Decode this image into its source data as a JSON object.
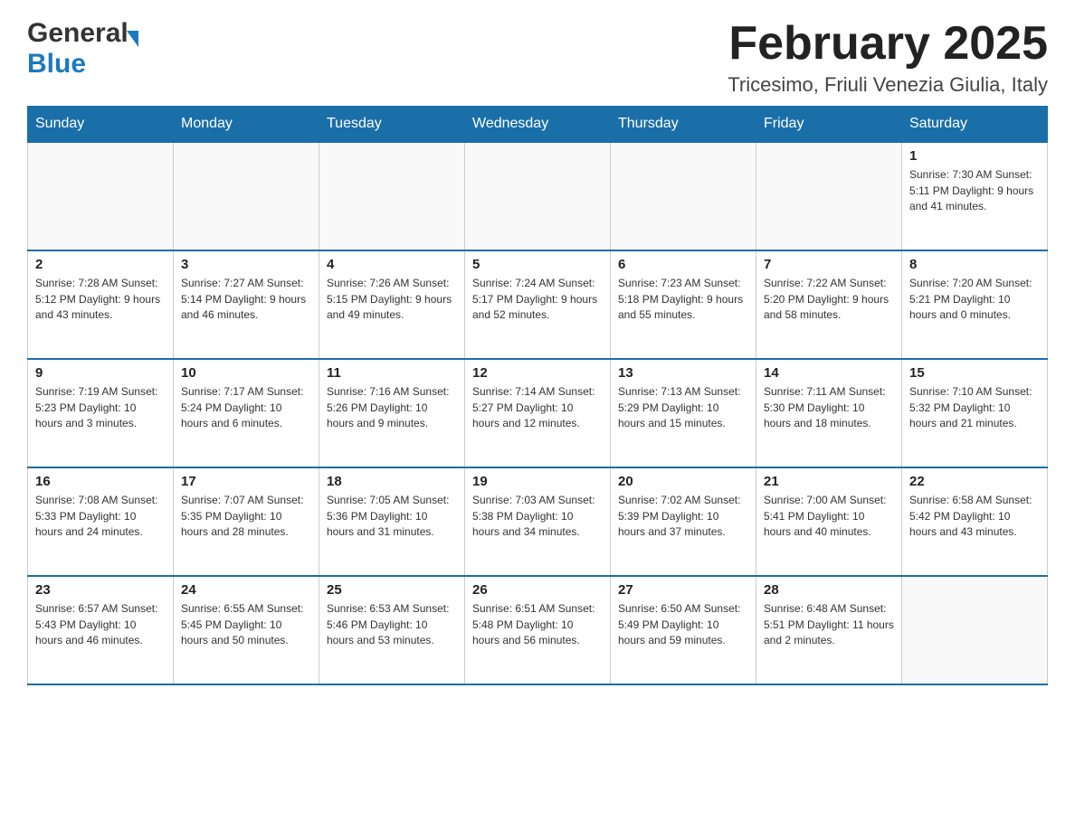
{
  "header": {
    "title": "February 2025",
    "location": "Tricesimo, Friuli Venezia Giulia, Italy",
    "logo_general": "General",
    "logo_blue": "Blue"
  },
  "days_of_week": [
    "Sunday",
    "Monday",
    "Tuesday",
    "Wednesday",
    "Thursday",
    "Friday",
    "Saturday"
  ],
  "weeks": [
    {
      "days": [
        {
          "num": "",
          "info": ""
        },
        {
          "num": "",
          "info": ""
        },
        {
          "num": "",
          "info": ""
        },
        {
          "num": "",
          "info": ""
        },
        {
          "num": "",
          "info": ""
        },
        {
          "num": "",
          "info": ""
        },
        {
          "num": "1",
          "info": "Sunrise: 7:30 AM\nSunset: 5:11 PM\nDaylight: 9 hours\nand 41 minutes."
        }
      ]
    },
    {
      "days": [
        {
          "num": "2",
          "info": "Sunrise: 7:28 AM\nSunset: 5:12 PM\nDaylight: 9 hours\nand 43 minutes."
        },
        {
          "num": "3",
          "info": "Sunrise: 7:27 AM\nSunset: 5:14 PM\nDaylight: 9 hours\nand 46 minutes."
        },
        {
          "num": "4",
          "info": "Sunrise: 7:26 AM\nSunset: 5:15 PM\nDaylight: 9 hours\nand 49 minutes."
        },
        {
          "num": "5",
          "info": "Sunrise: 7:24 AM\nSunset: 5:17 PM\nDaylight: 9 hours\nand 52 minutes."
        },
        {
          "num": "6",
          "info": "Sunrise: 7:23 AM\nSunset: 5:18 PM\nDaylight: 9 hours\nand 55 minutes."
        },
        {
          "num": "7",
          "info": "Sunrise: 7:22 AM\nSunset: 5:20 PM\nDaylight: 9 hours\nand 58 minutes."
        },
        {
          "num": "8",
          "info": "Sunrise: 7:20 AM\nSunset: 5:21 PM\nDaylight: 10 hours\nand 0 minutes."
        }
      ]
    },
    {
      "days": [
        {
          "num": "9",
          "info": "Sunrise: 7:19 AM\nSunset: 5:23 PM\nDaylight: 10 hours\nand 3 minutes."
        },
        {
          "num": "10",
          "info": "Sunrise: 7:17 AM\nSunset: 5:24 PM\nDaylight: 10 hours\nand 6 minutes."
        },
        {
          "num": "11",
          "info": "Sunrise: 7:16 AM\nSunset: 5:26 PM\nDaylight: 10 hours\nand 9 minutes."
        },
        {
          "num": "12",
          "info": "Sunrise: 7:14 AM\nSunset: 5:27 PM\nDaylight: 10 hours\nand 12 minutes."
        },
        {
          "num": "13",
          "info": "Sunrise: 7:13 AM\nSunset: 5:29 PM\nDaylight: 10 hours\nand 15 minutes."
        },
        {
          "num": "14",
          "info": "Sunrise: 7:11 AM\nSunset: 5:30 PM\nDaylight: 10 hours\nand 18 minutes."
        },
        {
          "num": "15",
          "info": "Sunrise: 7:10 AM\nSunset: 5:32 PM\nDaylight: 10 hours\nand 21 minutes."
        }
      ]
    },
    {
      "days": [
        {
          "num": "16",
          "info": "Sunrise: 7:08 AM\nSunset: 5:33 PM\nDaylight: 10 hours\nand 24 minutes."
        },
        {
          "num": "17",
          "info": "Sunrise: 7:07 AM\nSunset: 5:35 PM\nDaylight: 10 hours\nand 28 minutes."
        },
        {
          "num": "18",
          "info": "Sunrise: 7:05 AM\nSunset: 5:36 PM\nDaylight: 10 hours\nand 31 minutes."
        },
        {
          "num": "19",
          "info": "Sunrise: 7:03 AM\nSunset: 5:38 PM\nDaylight: 10 hours\nand 34 minutes."
        },
        {
          "num": "20",
          "info": "Sunrise: 7:02 AM\nSunset: 5:39 PM\nDaylight: 10 hours\nand 37 minutes."
        },
        {
          "num": "21",
          "info": "Sunrise: 7:00 AM\nSunset: 5:41 PM\nDaylight: 10 hours\nand 40 minutes."
        },
        {
          "num": "22",
          "info": "Sunrise: 6:58 AM\nSunset: 5:42 PM\nDaylight: 10 hours\nand 43 minutes."
        }
      ]
    },
    {
      "days": [
        {
          "num": "23",
          "info": "Sunrise: 6:57 AM\nSunset: 5:43 PM\nDaylight: 10 hours\nand 46 minutes."
        },
        {
          "num": "24",
          "info": "Sunrise: 6:55 AM\nSunset: 5:45 PM\nDaylight: 10 hours\nand 50 minutes."
        },
        {
          "num": "25",
          "info": "Sunrise: 6:53 AM\nSunset: 5:46 PM\nDaylight: 10 hours\nand 53 minutes."
        },
        {
          "num": "26",
          "info": "Sunrise: 6:51 AM\nSunset: 5:48 PM\nDaylight: 10 hours\nand 56 minutes."
        },
        {
          "num": "27",
          "info": "Sunrise: 6:50 AM\nSunset: 5:49 PM\nDaylight: 10 hours\nand 59 minutes."
        },
        {
          "num": "28",
          "info": "Sunrise: 6:48 AM\nSunset: 5:51 PM\nDaylight: 11 hours\nand 2 minutes."
        },
        {
          "num": "",
          "info": ""
        }
      ]
    }
  ]
}
